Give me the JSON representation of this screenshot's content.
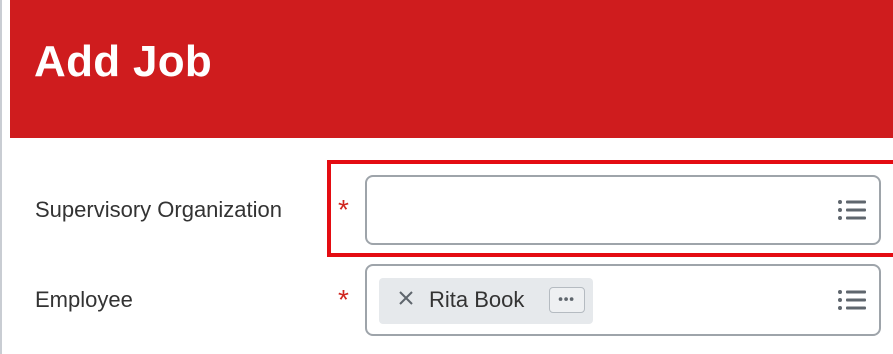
{
  "dialog": {
    "title": "Add Job"
  },
  "fields": {
    "supervisory_organization": {
      "label": "Supervisory Organization",
      "required_marker": "*",
      "value": "",
      "icon": "list-icon"
    },
    "employee": {
      "label": "Employee",
      "required_marker": "*",
      "selected": {
        "name": "Rita Book",
        "remove_icon": "close-icon",
        "more_icon": "ellipsis-icon"
      },
      "icon": "list-icon"
    }
  },
  "colors": {
    "header": "#cf1c1e",
    "required": "#d0261f",
    "highlight": "#e40c12",
    "chip": "#e6e9ec"
  }
}
